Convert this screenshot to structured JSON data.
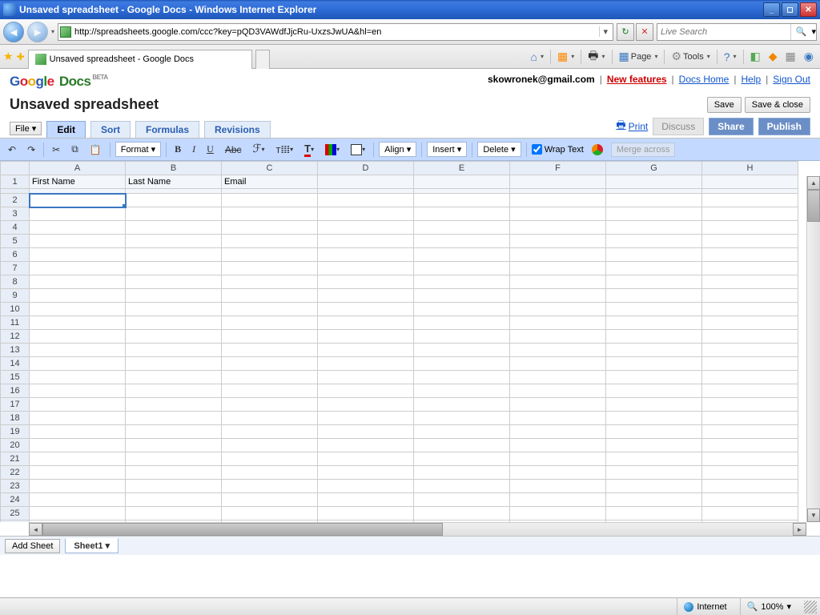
{
  "window": {
    "title": "Unsaved spreadsheet - Google Docs - Windows Internet Explorer"
  },
  "browser": {
    "url": "http://spreadsheets.google.com/ccc?key=pQD3VAWdfJjcRu-UxzsJwUA&hl=en",
    "search_placeholder": "Live Search",
    "tab_title": "Unsaved spreadsheet - Google Docs",
    "tools": {
      "page": "Page",
      "tools": "Tools"
    }
  },
  "gdocs": {
    "user_email": "skowronek@gmail.com",
    "links": {
      "new_features": "New features",
      "docs_home": "Docs Home",
      "help": "Help",
      "sign_out": "Sign Out"
    },
    "doc_title": "Unsaved spreadsheet",
    "buttons": {
      "save": "Save",
      "save_close": "Save & close",
      "file": "File",
      "print": "Print",
      "discuss": "Discuss",
      "share": "Share",
      "publish": "Publish",
      "add_sheet": "Add Sheet"
    },
    "tabs": {
      "edit": "Edit",
      "sort": "Sort",
      "formulas": "Formulas",
      "revisions": "Revisions"
    },
    "toolbar": {
      "format": "Format",
      "align": "Align",
      "insert": "Insert",
      "delete": "Delete",
      "wrap_text": "Wrap Text",
      "merge_across": "Merge across"
    },
    "sheet_name": "Sheet1"
  },
  "grid": {
    "columns": [
      "A",
      "B",
      "C",
      "D",
      "E",
      "F",
      "G",
      "H"
    ],
    "row_numbers": [
      1,
      2,
      3,
      4,
      5,
      6,
      7,
      8,
      9,
      10,
      11,
      12,
      13,
      14,
      15,
      16,
      17,
      18,
      19,
      20,
      21,
      22,
      23,
      24,
      25
    ],
    "header_row": [
      "First Name",
      "Last Name",
      "Email",
      "",
      "",
      "",
      "",
      ""
    ],
    "selected_cell": "A2"
  },
  "status": {
    "zone": "Internet",
    "zoom": "100%"
  }
}
